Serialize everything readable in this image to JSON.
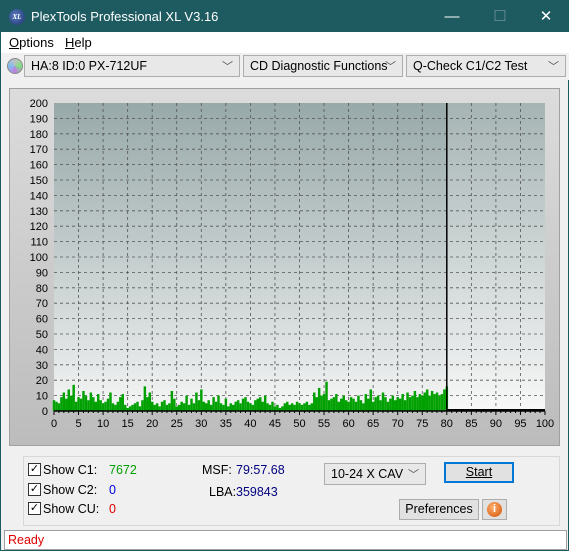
{
  "window": {
    "title": "PlexTools Professional XL V3.16",
    "icon_text": "XL",
    "minimize": "—",
    "maximize": "☐",
    "close": "✕"
  },
  "menu": {
    "items": [
      {
        "label": "Options",
        "u": "O",
        "rest": "ptions"
      },
      {
        "label": "Help",
        "u": "H",
        "rest": "elp"
      }
    ]
  },
  "toolbar": {
    "drive": "HA:8 ID:0  PX-712UF",
    "function": "CD Diagnostic Functions",
    "test": "Q-Check C1/C2 Test"
  },
  "chart_data": {
    "type": "bar",
    "xlim": [
      0,
      100
    ],
    "ylim": [
      0,
      200
    ],
    "x_ticks": [
      0,
      5,
      10,
      15,
      20,
      25,
      30,
      35,
      40,
      45,
      50,
      55,
      60,
      65,
      70,
      75,
      80,
      85,
      90,
      95,
      100
    ],
    "y_ticks": [
      0,
      10,
      20,
      30,
      40,
      50,
      60,
      70,
      80,
      90,
      100,
      110,
      120,
      130,
      140,
      150,
      160,
      170,
      180,
      190,
      200
    ],
    "grid": true,
    "end_marker_x": 80,
    "series": [
      {
        "color": "#00a000",
        "x_step": 0.5,
        "values": [
          7,
          6,
          5,
          9,
          12,
          8,
          14,
          10,
          17,
          6,
          9,
          8,
          13,
          10,
          7,
          12,
          9,
          6,
          11,
          7,
          5,
          6,
          8,
          12,
          5,
          4,
          6,
          9,
          11,
          4,
          2,
          3,
          4,
          5,
          6,
          3,
          7,
          16,
          9,
          12,
          6,
          4,
          5,
          3,
          6,
          7,
          4,
          5,
          13,
          8,
          3,
          4,
          6,
          5,
          10,
          4,
          8,
          5,
          12,
          7,
          14,
          6,
          5,
          7,
          4,
          9,
          6,
          10,
          5,
          4,
          8,
          3,
          5,
          4,
          6,
          7,
          5,
          8,
          9,
          6,
          5,
          4,
          7,
          8,
          9,
          6,
          10,
          5,
          4,
          6,
          3,
          4,
          2,
          3,
          5,
          6,
          4,
          5,
          4,
          6,
          5,
          4,
          5,
          6,
          4,
          5,
          12,
          9,
          15,
          10,
          11,
          19,
          7,
          8,
          9,
          11,
          6,
          8,
          10,
          7,
          6,
          9,
          8,
          6,
          10,
          7,
          5,
          11,
          8,
          14,
          6,
          9,
          10,
          7,
          12,
          9,
          6,
          8,
          10,
          7,
          9,
          8,
          11,
          7,
          12,
          9,
          10,
          13,
          9,
          11,
          10,
          12,
          14,
          10,
          13,
          11,
          12,
          10,
          11,
          14,
          16,
          17
        ]
      }
    ]
  },
  "stats": {
    "c1_label": "Show C1:",
    "c1_value": "7672",
    "c2_label": "Show C2:",
    "c2_value": "0",
    "cu_label": "Show CU:",
    "cu_value": "0",
    "msf_label": "MSF:",
    "msf_value": "79:57.68",
    "lba_label": "LBA:",
    "lba_value": "359843",
    "check": "✓"
  },
  "controls": {
    "speed": "10-24 X CAV",
    "start": "Start",
    "preferences": "Preferences",
    "info": "i"
  },
  "status": "Ready"
}
